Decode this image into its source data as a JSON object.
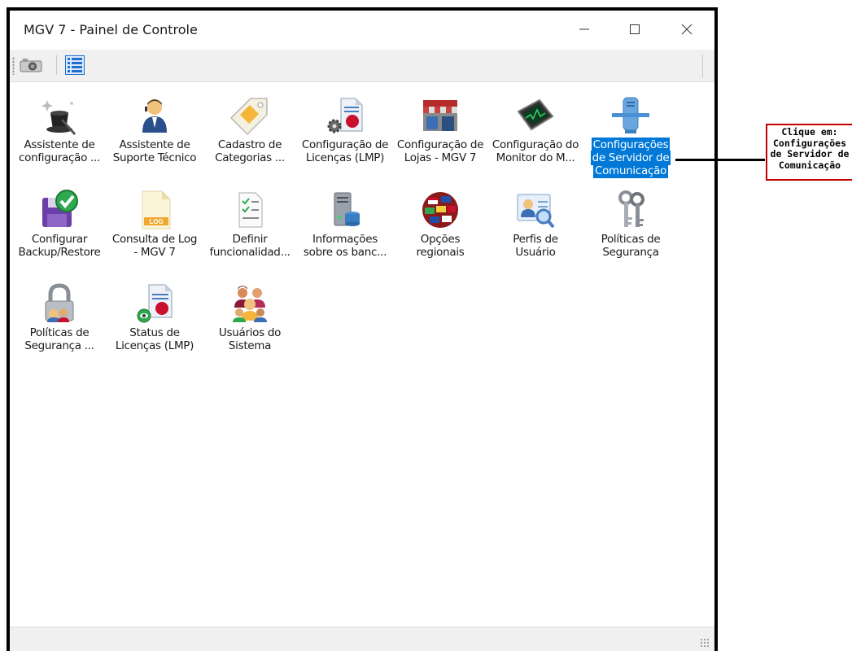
{
  "window": {
    "title": "MGV 7 - Painel de Controle",
    "minimize_label": "—",
    "maximize_label": "☐",
    "close_label": "✕"
  },
  "toolbar": {
    "buttons": [
      {
        "name": "camera-icon",
        "tooltip": ""
      },
      {
        "name": "list-view-icon",
        "tooltip": ""
      }
    ]
  },
  "items": [
    {
      "line1": "Assistente de",
      "line2": "configuração ...",
      "icon": "magic-hat-icon"
    },
    {
      "line1": "Assistente de",
      "line2": "Suporte Técnico",
      "icon": "support-person-icon"
    },
    {
      "line1": "Cadastro de",
      "line2": "Categorias ...",
      "icon": "tag-icon"
    },
    {
      "line1": "Configuração de",
      "line2": "Licenças (LMP)",
      "icon": "license-gear-icon"
    },
    {
      "line1": "Configuração de",
      "line2": "Lojas - MGV 7",
      "icon": "store-icon"
    },
    {
      "line1": "Configuração do",
      "line2": "Monitor do M...",
      "icon": "monitor-icon"
    },
    {
      "line1": "Configurações",
      "line2": "de Servidor de",
      "line3": "Comunicação",
      "icon": "server-network-icon",
      "selected": true
    },
    {
      "line1": "Configurar",
      "line2": "Backup/Restore",
      "icon": "backup-disk-icon"
    },
    {
      "line1": "Consulta de Log",
      "line2": "- MGV 7",
      "icon": "log-file-icon"
    },
    {
      "line1": "Definir",
      "line2": "funcionalidad...",
      "icon": "checklist-icon"
    },
    {
      "line1": "Informações",
      "line2": "sobre os banc...",
      "icon": "database-server-icon"
    },
    {
      "line1": "Opções",
      "line2": "regionais",
      "icon": "flags-globe-icon"
    },
    {
      "line1": "Perfis de",
      "line2": "Usuário",
      "icon": "user-profile-search-icon"
    },
    {
      "line1": "Políticas de",
      "line2": "Segurança",
      "icon": "keys-icon"
    },
    {
      "line1": "Políticas de",
      "line2": "Segurança ...",
      "icon": "padlock-icon"
    },
    {
      "line1": "Status de",
      "line2": "Licenças (LMP)",
      "icon": "license-status-icon"
    },
    {
      "line1": "Usuários do",
      "line2": "Sistema",
      "icon": "users-group-icon"
    }
  ],
  "callout": {
    "line1": "Clique em:",
    "line2": "Configurações",
    "line3": "de Servidor de",
    "line4": "Comunicação"
  },
  "colors": {
    "selection": "#0078d7",
    "callout_border": "#c00000"
  }
}
